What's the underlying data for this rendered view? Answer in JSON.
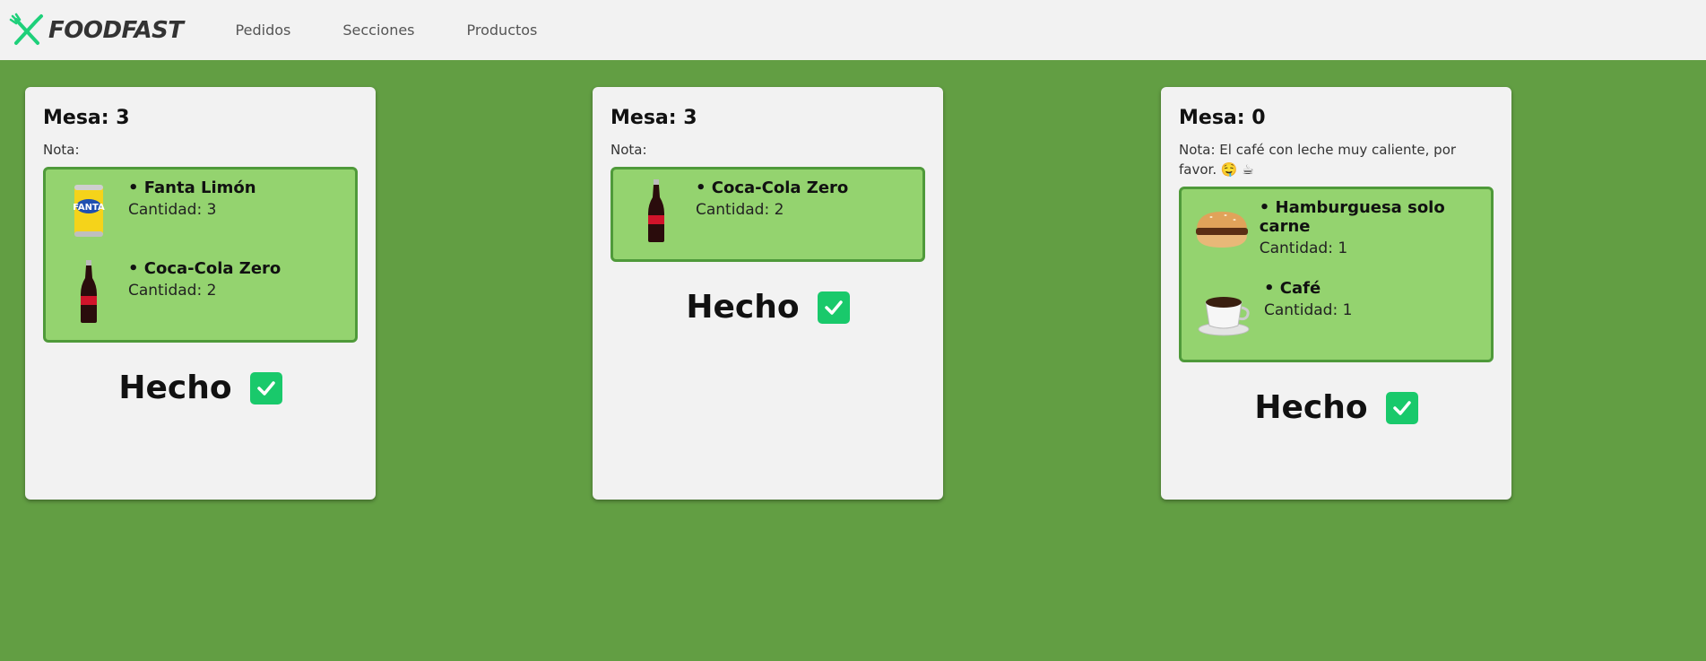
{
  "navbar": {
    "brand": "FOODFAST",
    "links": [
      "Pedidos",
      "Secciones",
      "Productos"
    ]
  },
  "colors": {
    "background": "#629e43",
    "items_bg": "#94d36f",
    "items_border": "#4f9a3a",
    "check": "#19c96b"
  },
  "orders": [
    {
      "title": "Mesa: 3",
      "note": "Nota:",
      "items": [
        {
          "name": "• Fanta Limón",
          "qty": "Cantidad: 3",
          "icon": "fanta-can-icon"
        },
        {
          "name": "• Coca-Cola Zero",
          "qty": "Cantidad: 2",
          "icon": "cola-bottle-icon"
        }
      ],
      "done": "Hecho"
    },
    {
      "title": "Mesa: 3",
      "note": "Nota:",
      "items": [
        {
          "name": "• Coca-Cola Zero",
          "qty": "Cantidad: 2",
          "icon": "cola-bottle-icon"
        }
      ],
      "done": "Hecho"
    },
    {
      "title": "Mesa: 0",
      "note": "Nota: El café con leche muy caliente, por favor. 🤤 ☕",
      "items": [
        {
          "name": "• Hamburguesa solo carne",
          "qty": "Cantidad: 1",
          "icon": "burger-icon"
        },
        {
          "name": "• Café",
          "qty": "Cantidad: 1",
          "icon": "coffee-cup-icon"
        }
      ],
      "done": "Hecho"
    }
  ]
}
